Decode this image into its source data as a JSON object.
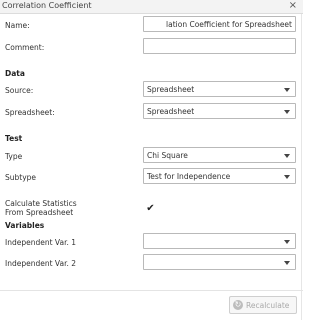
{
  "window": {
    "title": "Correlation Coefficient",
    "close_icon": "close-icon"
  },
  "form": {
    "name_label": "Name:",
    "name_value": "lation Coefficient for Spreadsheet",
    "comment_label": "Comment:",
    "comment_value": "",
    "data_heading": "Data",
    "source_label": "Source:",
    "source_value": "Spreadsheet",
    "spreadsheet_label": "Spreadsheet:",
    "spreadsheet_value": "Spreadsheet",
    "test_heading": "Test",
    "type_label": "Type",
    "type_value": "Chi Square",
    "subtype_label": "Subtype",
    "subtype_value": "Test for Independence",
    "calc_label_line1": "Calculate Statistics",
    "calc_label_line2": "From Spreadsheet",
    "calc_checked": true,
    "variables_heading": "Variables",
    "indep1_label": "Independent Var. 1",
    "indep1_value": "",
    "indep2_label": "Independent Var. 2",
    "indep2_value": ""
  },
  "footer": {
    "recalculate_label": "Recalculate",
    "recalculate_icon": "refresh-icon"
  }
}
